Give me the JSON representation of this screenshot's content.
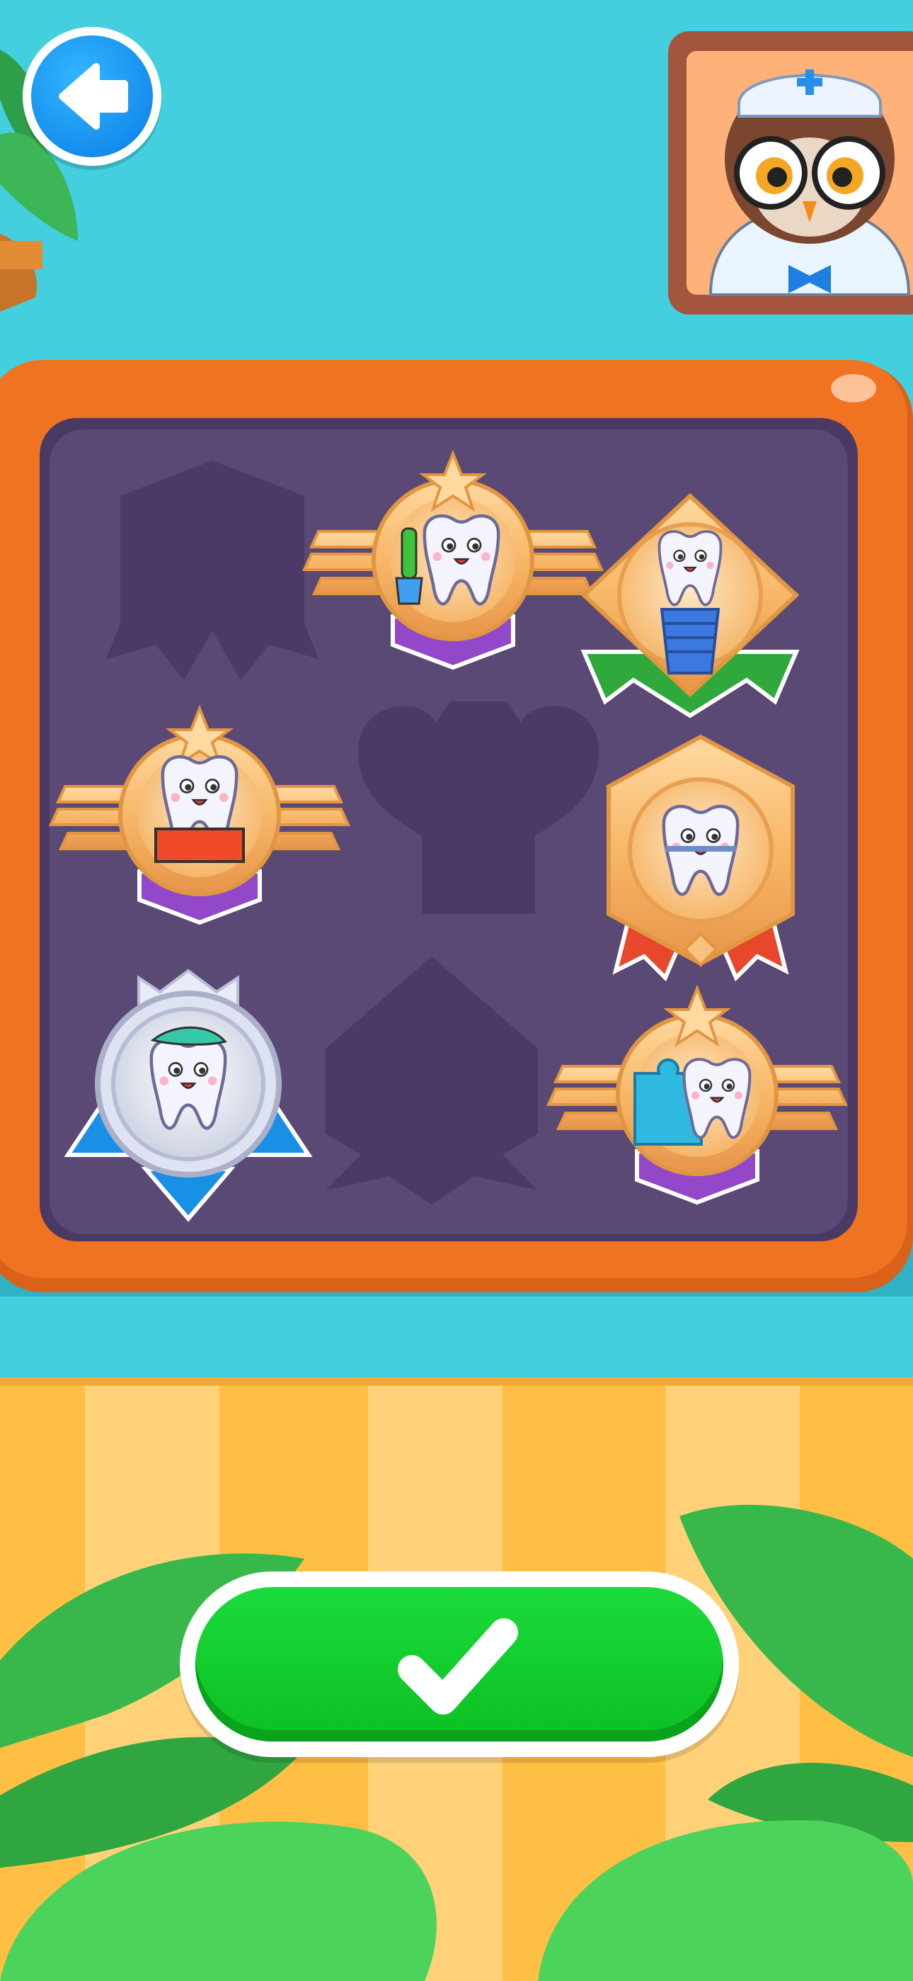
{
  "screen": "badge-collection",
  "colors": {
    "sky": "#44cfdf",
    "board_frame": "#ef7320",
    "board_inner": "#5a4875",
    "stripes_light": "#ffd27a",
    "stripes_dark": "#ffbe44",
    "leaf": "#38b84a",
    "confirm": "#0bc926",
    "back": "#0a7be6"
  },
  "buttons": {
    "back": {
      "icon": "arrow-left-icon"
    },
    "confirm": {
      "icon": "checkmark-icon"
    }
  },
  "portrait": {
    "icon": "owl-doctor-icon"
  },
  "badges": [
    {
      "slot": 1,
      "unlocked": false,
      "icon": "badge-silhouette-icon"
    },
    {
      "slot": 2,
      "unlocked": true,
      "style": "gold-winged",
      "icon": "tooth-toothbrush-icon"
    },
    {
      "slot": 3,
      "unlocked": true,
      "style": "gold-diamond",
      "icon": "tooth-implant-icon"
    },
    {
      "slot": 4,
      "unlocked": true,
      "style": "gold-winged",
      "icon": "tooth-gum-icon"
    },
    {
      "slot": 5,
      "unlocked": false,
      "icon": "badge-silhouette-icon"
    },
    {
      "slot": 6,
      "unlocked": true,
      "style": "gold-hexagon",
      "icon": "tooth-braces-icon"
    },
    {
      "slot": 7,
      "unlocked": true,
      "style": "silver-rosette",
      "icon": "tooth-toothpaste-icon"
    },
    {
      "slot": 8,
      "unlocked": false,
      "icon": "badge-silhouette-icon"
    },
    {
      "slot": 9,
      "unlocked": true,
      "style": "gold-winged",
      "icon": "tooth-puzzle-icon"
    }
  ]
}
